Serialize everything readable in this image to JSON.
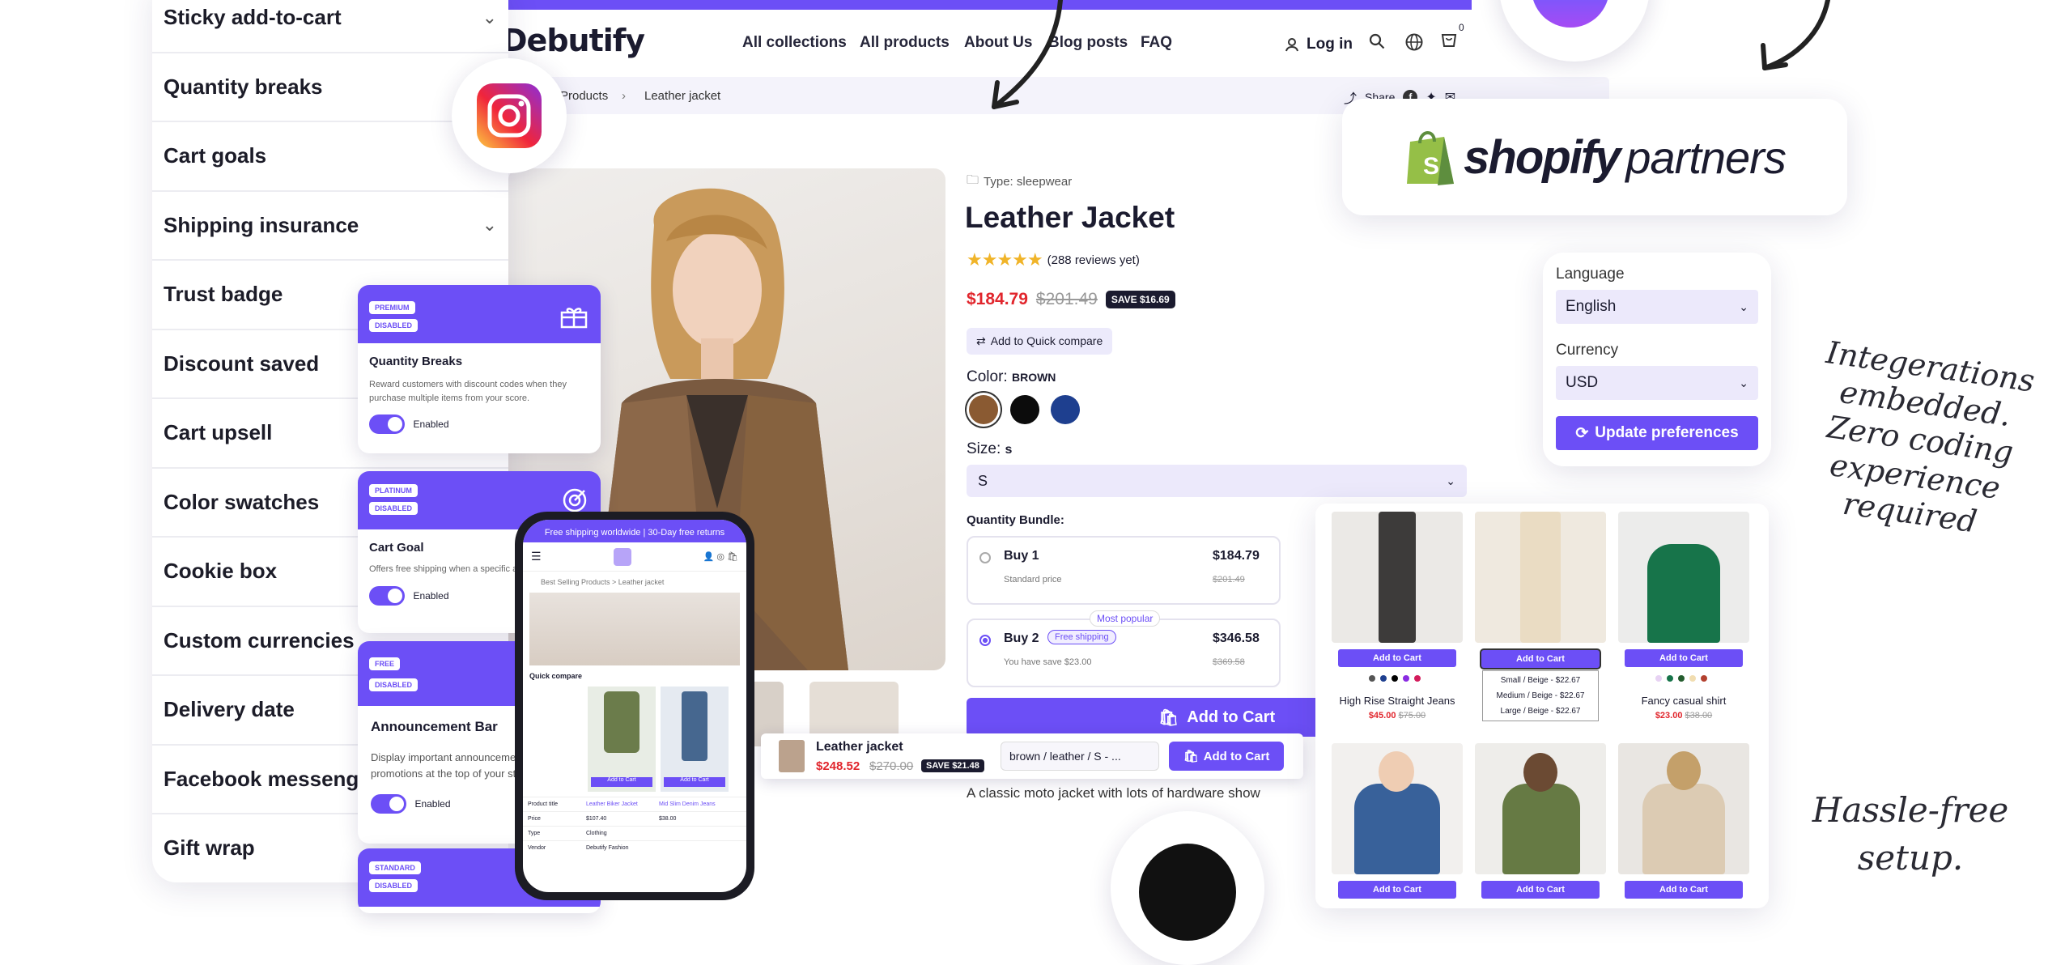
{
  "features": [
    {
      "label": "Sticky add-to-cart",
      "chevron": true
    },
    {
      "label": "Quantity breaks",
      "chevron": false
    },
    {
      "label": "Cart goals",
      "chevron": false
    },
    {
      "label": "Shipping insurance",
      "chevron": true
    },
    {
      "label": "Trust badge",
      "chevron": false
    },
    {
      "label": "Discount saved",
      "chevron": false
    },
    {
      "label": "Cart upsell",
      "chevron": false
    },
    {
      "label": "Color swatches",
      "chevron": false
    },
    {
      "label": "Cookie box",
      "chevron": false
    },
    {
      "label": "Custom currencies",
      "chevron": false
    },
    {
      "label": "Delivery date",
      "chevron": false
    },
    {
      "label": "Facebook messenger",
      "chevron": false
    },
    {
      "label": "Gift wrap",
      "chevron": false
    }
  ],
  "store": {
    "logo": "Debutify",
    "nav": [
      "All collections",
      "All products",
      "About Us",
      "Blog posts",
      "FAQ"
    ],
    "login": "Log in",
    "cart_count": "0",
    "breadcrumb": [
      "Products",
      "Leather jacket"
    ],
    "share": "Share"
  },
  "product": {
    "type": "Type: sleepwear",
    "title": "Leather Jacket",
    "reviews": "(288 reviews yet)",
    "price": "$184.79",
    "compare_price": "$201.49",
    "save_badge": "SAVE $16.69",
    "quick_compare": "Add to Quick compare",
    "color_label": "Color:",
    "color_value": "BROWN",
    "swatch_colors": [
      "#8a5a32",
      "#0c0c0c",
      "#1e3f8f"
    ],
    "size_label": "Size:",
    "size_value": "s",
    "size_select": "S",
    "bundle_label": "Quantity Bundle:",
    "bundles": [
      {
        "name": "Buy 1",
        "sub": "Standard price",
        "price": "$184.79",
        "old": "$201.49"
      },
      {
        "name": "Buy 2",
        "tag": "Free shipping",
        "sub": "You have save $23.00",
        "price": "$346.58",
        "old": "$369.58",
        "badge": "Most popular"
      }
    ],
    "add_to_cart": "Add to Cart",
    "description": "A classic moto jacket with lots of hardware show"
  },
  "sticky_bar": {
    "title": "Leather jacket",
    "price": "$248.52",
    "old": "$270.00",
    "save": "SAVE $21.48",
    "variant": "brown / leather / S - ...",
    "button": "Add to Cart"
  },
  "premium_cards": [
    {
      "tier": "PREMIUM",
      "status": "DISABLED",
      "title": "Quantity Breaks",
      "desc": "Reward customers with discount codes when they purchase multiple items from your score.",
      "toggle": "Enabled"
    },
    {
      "tier": "PLATINUM",
      "status": "DISABLED",
      "title": "Cart Goal",
      "desc": "Offers free shipping when a specific amount is reached.",
      "toggle": "Enabled"
    },
    {
      "tier": "FREE",
      "status": "DISABLED",
      "title": "Announcement Bar",
      "desc": "Display important announcements, promotions at the top of your store.",
      "toggle": "Enabled"
    },
    {
      "tier": "STANDARD",
      "status": "DISABLED"
    }
  ],
  "phone": {
    "banner": "Free shipping worldwide | 30-Day free returns",
    "crumbs": "Best Selling Products  >  Leather jacket",
    "compare_title": "Quick compare",
    "rows": [
      {
        "label": "Product title",
        "a": "Leather Biker Jacket",
        "b": "Mid Slim Denim Jeans"
      },
      {
        "label": "Price",
        "a": "$107.40",
        "b": "$38.00"
      },
      {
        "label": "Type",
        "a": "Clothing",
        "b": ""
      },
      {
        "label": "Vendor",
        "a": "Debutify Fashion",
        "b": ""
      }
    ],
    "add": "Add to Cart"
  },
  "shopify": {
    "brand": "shopify",
    "suffix": "partners"
  },
  "prefs": {
    "language_label": "Language",
    "language_value": "English",
    "currency_label": "Currency",
    "currency_value": "USD",
    "button": "Update preferences"
  },
  "grid": {
    "items": [
      {
        "button": "Add to Cart",
        "name": "High Rise Straight Jeans",
        "price": "$45.00",
        "old": "$75.00",
        "img": "#3d3b3a",
        "bg": "#ebe9e6"
      },
      {
        "button": "Add to Cart",
        "name": "",
        "price": "",
        "old": "",
        "img": "#eadcc3",
        "bg": "#efe9df",
        "dropdown": [
          "Small / Beige - $22.67",
          "Medium / Beige - $22.67",
          "Large / Beige - $22.67"
        ]
      },
      {
        "button": "Add to Cart",
        "name": "Fancy casual shirt",
        "price": "$23.00",
        "old": "$38.00",
        "img": "#17744a",
        "bg": "#ececeb"
      }
    ],
    "row2_button": "Add to Cart"
  },
  "handwritten": {
    "integrations": [
      "Integerations",
      "embedded.",
      "Zero coding",
      "experience",
      "required"
    ],
    "hassle": [
      "Hassle-free",
      "setup."
    ]
  }
}
